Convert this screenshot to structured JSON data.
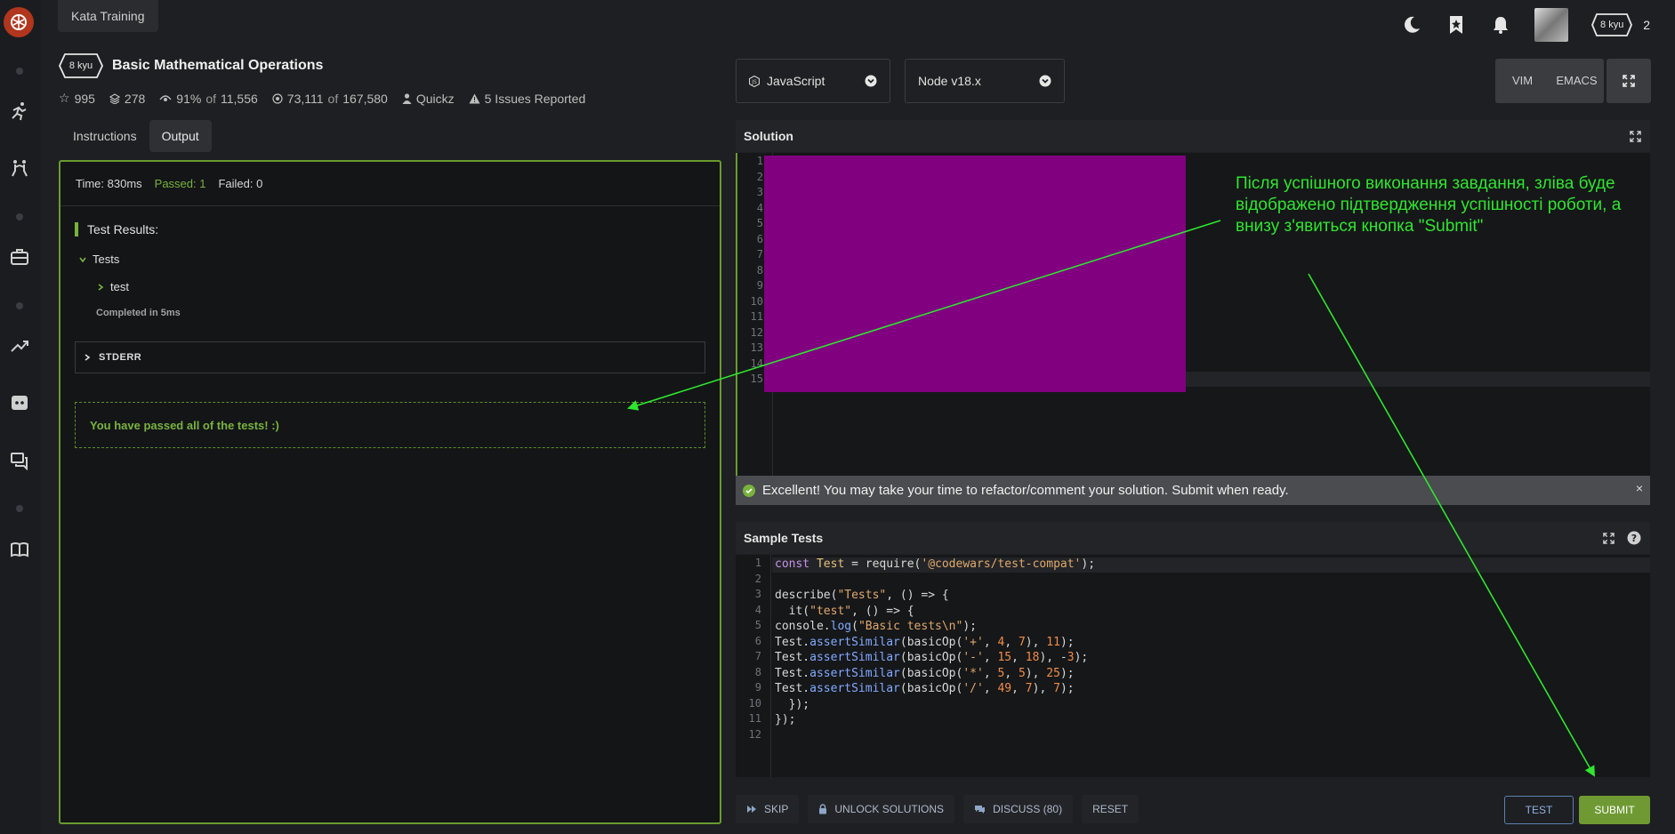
{
  "app": {
    "tab_label": "Kata Training"
  },
  "header": {
    "notifications_count": "2",
    "user_rank": "8 kyu"
  },
  "kata": {
    "rank": "8 kyu",
    "title": "Basic Mathematical Operations",
    "stats": {
      "stars": "995",
      "collections": "278",
      "satisfaction": "91%",
      "of_label": "of",
      "satisfaction_total": "11,556",
      "completed": "73,111",
      "completed_total": "167,580",
      "author": "Quickz",
      "issues": "5 Issues Reported"
    }
  },
  "left_tabs": [
    "Instructions",
    "Output"
  ],
  "output": {
    "time": "Time: 830ms",
    "passed": "Passed: 1",
    "failed": "Failed: 0",
    "results_title": "Test Results:",
    "group": "Tests",
    "test": "test",
    "completed": "Completed in 5ms",
    "stderr": "STDERR",
    "pass_message": "You have passed all of the tests! :)"
  },
  "toolbar": {
    "language": "JavaScript",
    "runtime": "Node v18.x",
    "vim": "VIM",
    "emacs": "EMACS"
  },
  "solution": {
    "title": "Solution",
    "line_numbers": [
      "1",
      "2",
      "3",
      "4",
      "5",
      "6",
      "7",
      "8",
      "9",
      "10",
      "11",
      "12",
      "13",
      "14",
      "15"
    ]
  },
  "notice": {
    "text": "Excellent! You may take your time to refactor/comment your solution. Submit when ready.",
    "close": "×"
  },
  "sample_tests": {
    "title": "Sample Tests",
    "line_numbers": [
      "1",
      "2",
      "3",
      "4",
      "5",
      "6",
      "7",
      "8",
      "9",
      "10",
      "11",
      "12"
    ]
  },
  "bottom": {
    "skip": "SKIP",
    "unlock": "UNLOCK SOLUTIONS",
    "discuss": "DISCUSS (80)",
    "reset": "RESET",
    "test": "TEST",
    "submit": "SUBMIT"
  },
  "annotation": {
    "text": "Після успішного виконання завдання, зліва буде відображено підтвердження успішності роботи, а внизу з'явиться кнопка \"Submit\""
  },
  "colors": {
    "accent_green": "#78b33d",
    "annotation_green": "#2ee62e",
    "redaction": "#800080",
    "submit_bg": "#6f9a33",
    "brand_red": "#b1361e"
  }
}
